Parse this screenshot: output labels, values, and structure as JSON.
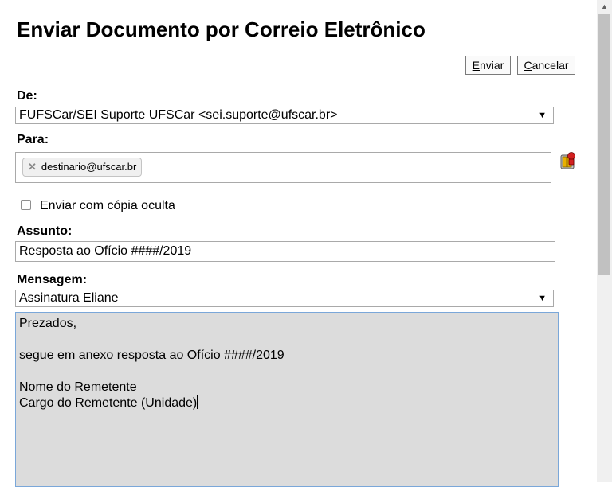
{
  "dialog": {
    "title": "Enviar Documento por Correio Eletrônico"
  },
  "toolbar": {
    "send": {
      "accesskey": "E",
      "rest": "nviar"
    },
    "cancel": {
      "accesskey": "C",
      "rest": "ancelar"
    }
  },
  "from": {
    "label": "De:",
    "selected": "FUFSCar/SEI Suporte UFSCar <sei.suporte@ufscar.br>"
  },
  "to": {
    "label": "Para:",
    "recipients": [
      "destinario@ufscar.br"
    ]
  },
  "bcc": {
    "label": "Enviar com cópia oculta",
    "checked": false
  },
  "subject": {
    "label": "Assunto:",
    "value": "Resposta ao Ofício ####/2019"
  },
  "message": {
    "label": "Mensagem:",
    "template_selected": "Assinatura Eliane",
    "body_lines": [
      "Prezados,",
      "",
      "segue em anexo resposta ao Ofício ####/2019",
      "",
      "Nome do Remetente",
      "Cargo do Remetente (Unidade)"
    ]
  },
  "colors": {
    "message_bg": "#dcdcdc",
    "focus_border": "#7aa7d9"
  },
  "icons": {
    "address_book": "address-book-icon",
    "remove_recipient": "close-icon",
    "dropdown": "chevron-down-icon"
  }
}
